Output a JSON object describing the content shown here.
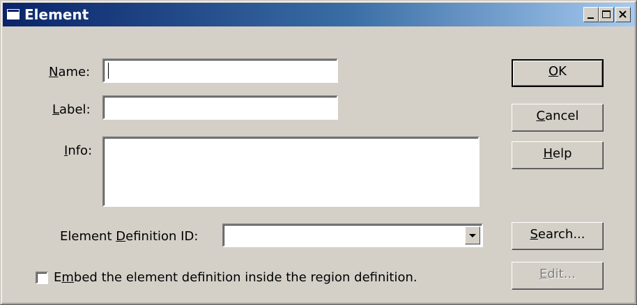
{
  "window": {
    "title": "Element",
    "controls": {
      "minimize": "minimize-icon",
      "maximize": "maximize-icon",
      "close": "close-icon"
    },
    "titlebar_gradient": [
      "#0a246a",
      "#a6caf0"
    ],
    "face_color": "#d4d0c8"
  },
  "form": {
    "name": {
      "label_mnemonic": "N",
      "label_rest": "ame:",
      "value": ""
    },
    "label": {
      "label_mnemonic": "L",
      "label_rest": "abel:",
      "value": ""
    },
    "info": {
      "label_mnemonic": "I",
      "label_rest": "nfo:",
      "value": ""
    },
    "element_definition_id": {
      "label_prefix": "Element ",
      "label_mnemonic": "D",
      "label_rest": "efinition ID:",
      "value": ""
    },
    "embed_checkbox": {
      "label_prefix": "E",
      "label_mnemonic": "m",
      "label_rest": "bed the element definition inside the region definition.",
      "checked": false
    }
  },
  "buttons": {
    "ok": {
      "mnemonic": "O",
      "rest": "K"
    },
    "cancel": {
      "mnemonic": "C",
      "rest": "ancel"
    },
    "help": {
      "mnemonic": "H",
      "rest": "elp"
    },
    "search": {
      "mnemonic": "S",
      "rest": "earch..."
    },
    "edit": {
      "mnemonic": "E",
      "rest": "dit..."
    }
  }
}
